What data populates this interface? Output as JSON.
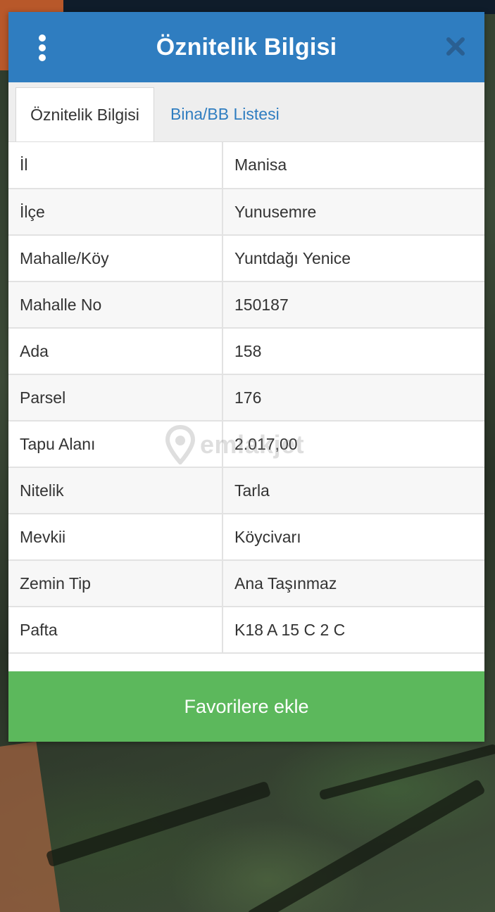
{
  "dialog": {
    "title": "Öznitelik Bilgisi",
    "menu_icon": "more-vertical-icon",
    "close_icon": "close-icon"
  },
  "tabs": [
    {
      "label": "Öznitelik Bilgisi",
      "active": true
    },
    {
      "label": "Bina/BB Listesi",
      "active": false
    }
  ],
  "attributes": [
    {
      "label": "İl",
      "value": "Manisa"
    },
    {
      "label": "İlçe",
      "value": "Yunusemre"
    },
    {
      "label": "Mahalle/Köy",
      "value": "Yuntdağı Yenice"
    },
    {
      "label": "Mahalle No",
      "value": "150187"
    },
    {
      "label": "Ada",
      "value": "158"
    },
    {
      "label": "Parsel",
      "value": "176"
    },
    {
      "label": "Tapu Alanı",
      "value": "2.017,00"
    },
    {
      "label": "Nitelik",
      "value": "Tarla"
    },
    {
      "label": "Mevkii",
      "value": "Köycivarı"
    },
    {
      "label": "Zemin Tip",
      "value": "Ana Taşınmaz"
    },
    {
      "label": "Pafta",
      "value": "K18 A 15 C 2 C"
    }
  ],
  "actions": {
    "favorite_label": "Favorilere ekle"
  },
  "watermark": {
    "text": "emlakjet",
    "icon": "location-pin-icon"
  },
  "colors": {
    "header": "#2f7dc0",
    "tab_link": "#2f7dc0",
    "favorite_button": "#5cb85c"
  }
}
